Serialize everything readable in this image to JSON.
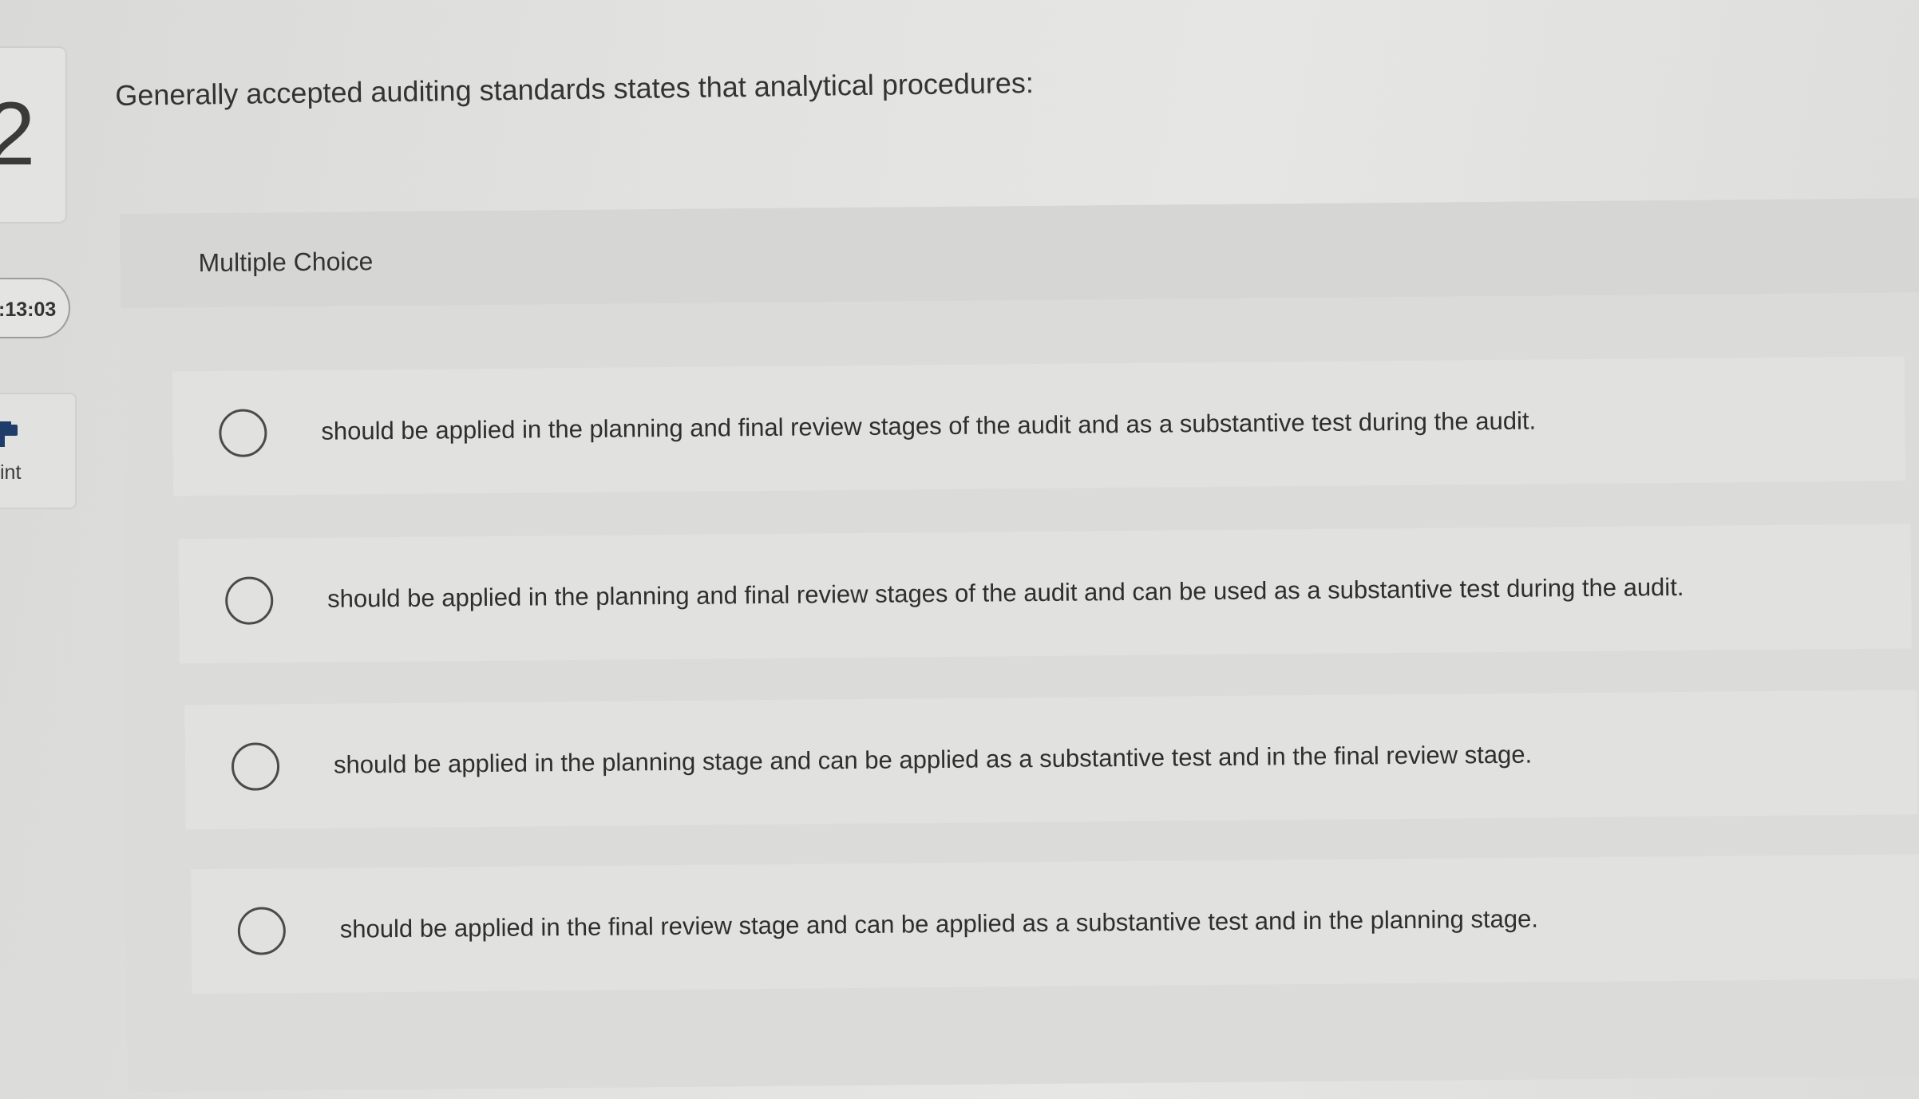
{
  "sidebar": {
    "question_number": "2",
    "timer": ":13:03",
    "print_label": "int"
  },
  "question": {
    "prompt": "Generally accepted auditing standards states that analytical procedures:",
    "type_label": "Multiple Choice",
    "options": [
      {
        "text": "should be applied in the planning and final review stages of the audit and as a substantive test during the audit."
      },
      {
        "text": "should be applied in the planning and final review stages of the audit and can be used as a substantive test during the audit."
      },
      {
        "text": "should be applied in the planning stage and can be applied as a substantive test and in the final review stage."
      },
      {
        "text": "should be applied in the final review stage and can be applied as a substantive test and in the planning stage."
      }
    ]
  },
  "icons": {
    "print": "printer-icon",
    "radio": "radio-unchecked-icon"
  }
}
